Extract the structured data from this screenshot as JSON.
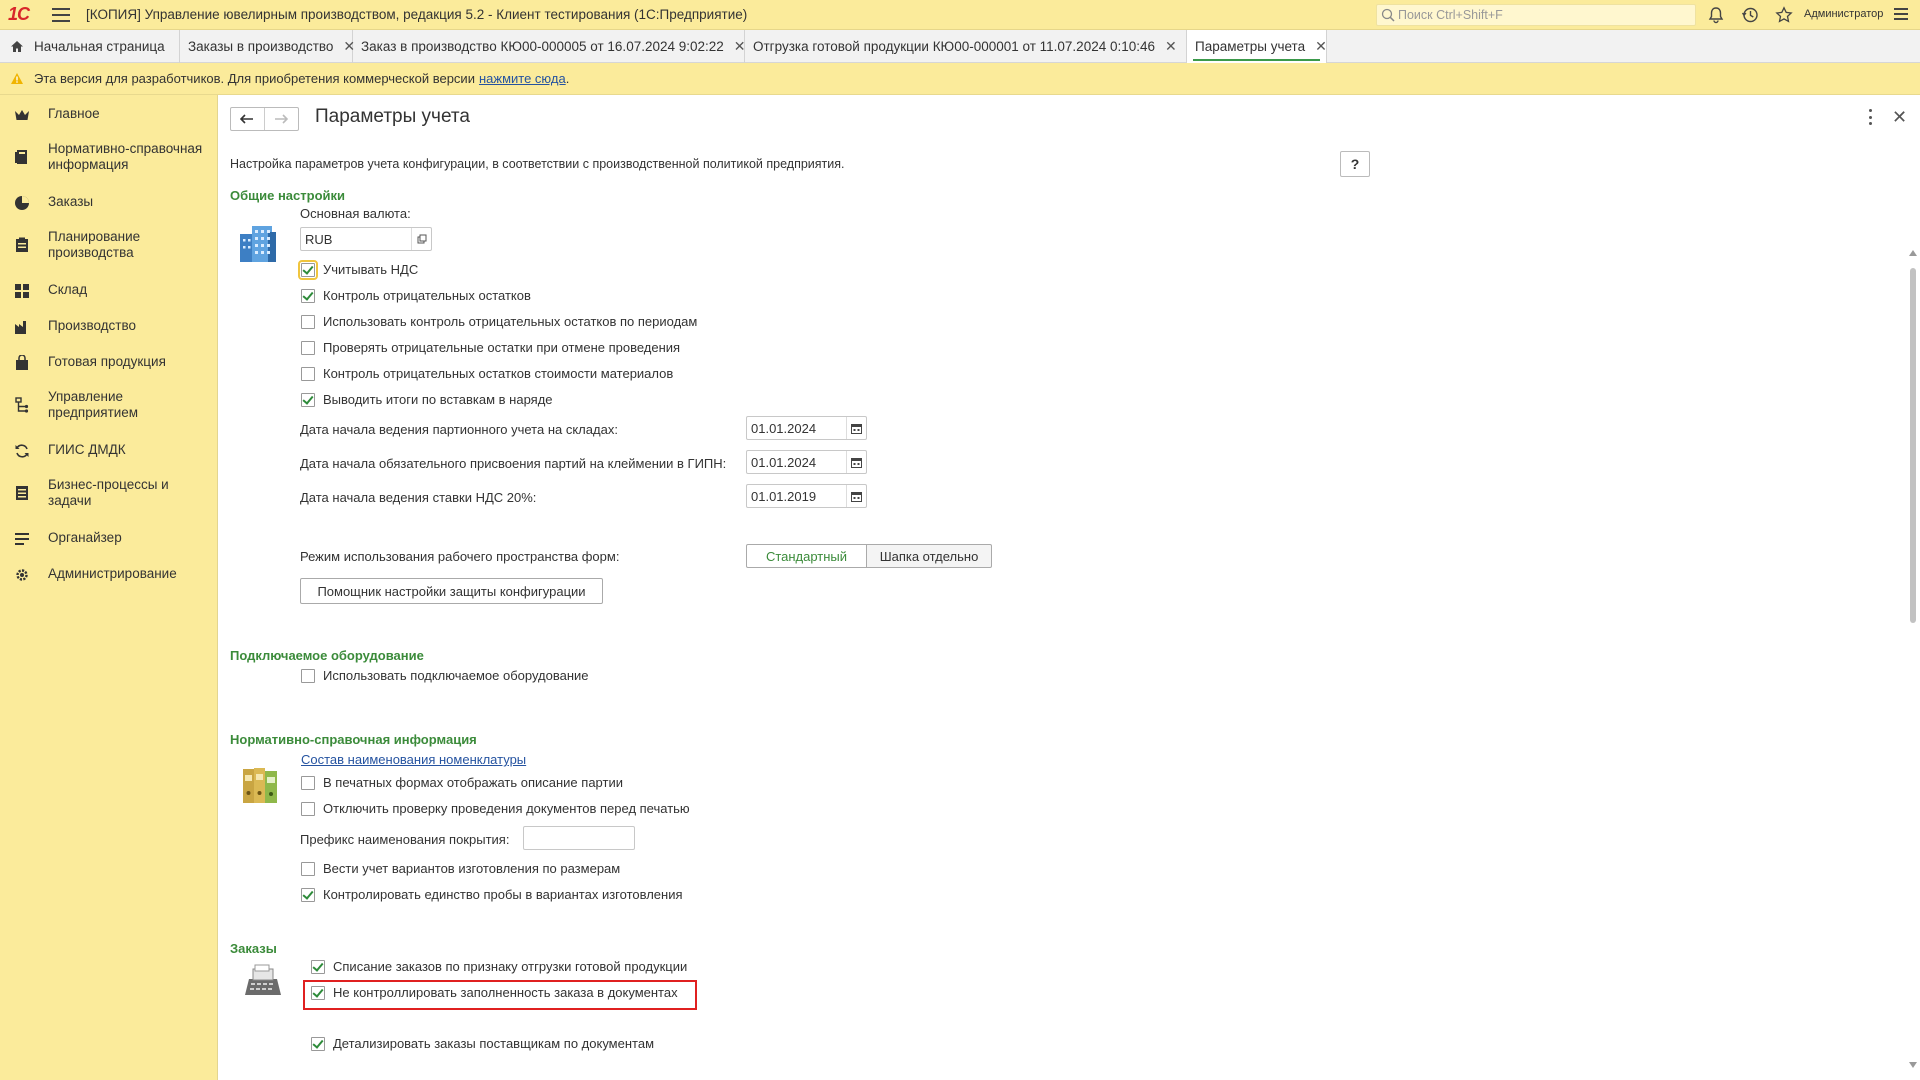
{
  "titlebar": {
    "app_title": "[КОПИЯ] Управление ювелирным производством, редакция 5.2  - Клиент тестирования (1С:Предприятие)",
    "search_placeholder": "Поиск Ctrl+Shift+F",
    "user": "Администратор",
    "logo": "1С"
  },
  "tabs": [
    {
      "label": "Начальная страница"
    },
    {
      "label": "Заказы в производство"
    },
    {
      "label": "Заказ в производство КЮ00-000005 от 16.07.2024 9:02:22"
    },
    {
      "label": "Отгрузка готовой продукции КЮ00-000001 от 11.07.2024 0:10:46"
    },
    {
      "label": "Параметры учета"
    }
  ],
  "infobar": {
    "text": "Эта версия для разработчиков. Для приобретения коммерческой версии",
    "link": "нажмите сюда",
    "tail": "."
  },
  "sidebar": {
    "items": [
      {
        "label": "Главное",
        "icon": "crown-icon"
      },
      {
        "label": "Нормативно-справочная информация",
        "icon": "book-icon"
      },
      {
        "label": "Заказы",
        "icon": "pie-chart-icon"
      },
      {
        "label": "Планирование производства",
        "icon": "clipboard-icon"
      },
      {
        "label": "Склад",
        "icon": "grid-icon"
      },
      {
        "label": "Производство",
        "icon": "factory-icon"
      },
      {
        "label": "Готовая продукция",
        "icon": "bag-icon"
      },
      {
        "label": "Управление предприятием",
        "icon": "org-icon"
      },
      {
        "label": "ГИИС ДМДК",
        "icon": "refresh-icon"
      },
      {
        "label": "Бизнес-процессы и задачи",
        "icon": "tasks-icon"
      },
      {
        "label": "Органайзер",
        "icon": "organizer-icon"
      },
      {
        "label": "Администрирование",
        "icon": "gear-icon"
      }
    ]
  },
  "form": {
    "title": "Параметры учета",
    "description": "Настройка параметров учета конфигурации, в соответствии с производственной политикой предприятия.",
    "help": "?",
    "general": {
      "section": "Общие настройки",
      "currency_label": "Основная валюта:",
      "currency_value": "RUB",
      "checkboxes": [
        {
          "label": "Учитывать НДС",
          "checked": true
        },
        {
          "label": "Контроль отрицательных остатков",
          "checked": true
        },
        {
          "label": "Использовать контроль отрицательных остатков по периодам",
          "checked": false
        },
        {
          "label": "Проверять отрицательные остатки при отмене проведения",
          "checked": false
        },
        {
          "label": "Контроль отрицательных остатков стоимости материалов",
          "checked": false
        },
        {
          "label": "Выводить итоги по вставкам в наряде",
          "checked": true
        }
      ],
      "dates": [
        {
          "label": "Дата начала ведения партионного учета на складах:",
          "value": "01.01.2024"
        },
        {
          "label": "Дата начала обязательного присвоения партий на клеймении в ГИПН:",
          "value": "01.01.2024"
        },
        {
          "label": "Дата начала ведения ставки НДС 20%:",
          "value": "01.01.2019"
        }
      ],
      "workspace_label": "Режим использования рабочего пространства форм:",
      "workspace_options": [
        "Стандартный",
        "Шапка отдельно"
      ],
      "workspace_selected": "Стандартный",
      "protection_button": "Помощник настройки защиты конфигурации"
    },
    "equipment": {
      "section": "Подключаемое оборудование",
      "checkbox": {
        "label": "Использовать подключаемое оборудование",
        "checked": false
      }
    },
    "nsi": {
      "section": "Нормативно-справочная информация",
      "link": "Состав наименования номенклатуры",
      "checkboxes": [
        {
          "label": "В печатных формах отображать описание партии",
          "checked": false
        },
        {
          "label": "Отключить проверку проведения документов перед печатью",
          "checked": false
        }
      ],
      "prefix_label": "Префикс наименования покрытия:",
      "prefix_value": "",
      "checkboxes2": [
        {
          "label": "Вести учет вариантов изготовления по размерам",
          "checked": false
        },
        {
          "label": "Контролировать единство пробы в вариантах изготовления",
          "checked": true
        }
      ]
    },
    "orders": {
      "section": "Заказы",
      "checkboxes": [
        {
          "label": "Списание заказов по признаку отгрузки готовой продукции",
          "checked": true
        },
        {
          "label": "Не контроллировать заполненность заказа в документах",
          "checked": true
        },
        {
          "label": "Детализировать заказы поставщикам по документам",
          "checked": true
        }
      ]
    }
  },
  "colors": {
    "accent_yellow": "#fbeb9b",
    "section_green": "#3b8b3a",
    "highlight_red": "#e02020",
    "link_blue": "#2553a0"
  }
}
